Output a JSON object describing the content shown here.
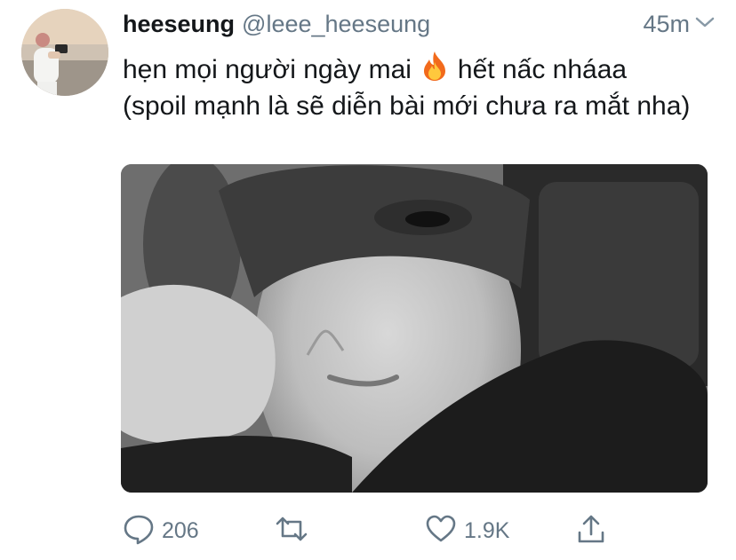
{
  "tweet": {
    "author_name": "heeseung",
    "author_handle": "@leee_heeseung",
    "time": "45m",
    "text_part1": "hẹn mọi người ngày mai",
    "text_part2": "hết nấc nháaa (spoil mạnh là sẽ diễn bài mới chưa ra mắt nha)",
    "emoji": "fire-emoji"
  },
  "actions": {
    "reply_count": "206",
    "like_count": "1.9K"
  },
  "icons": {
    "reply": "speech-bubble-icon",
    "retweet": "retweet-arrows-icon",
    "like": "heart-icon",
    "share": "share-upload-icon",
    "more": "chevron-down-icon"
  },
  "colors": {
    "text": "#14171a",
    "secondary": "#657786",
    "background": "#ffffff"
  }
}
